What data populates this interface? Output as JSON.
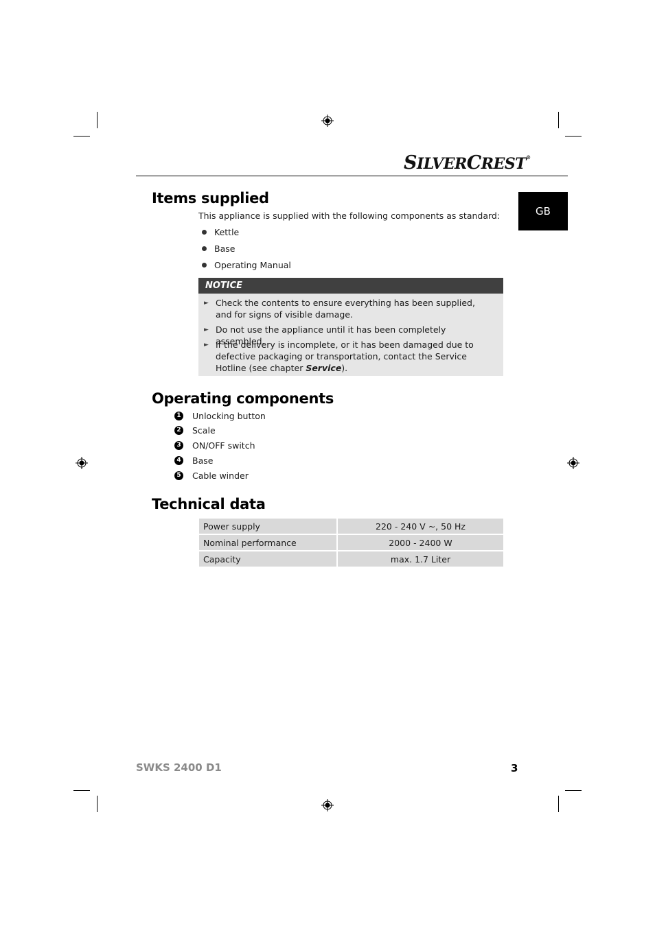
{
  "brand": {
    "logo_text_first": "S",
    "logo_text_rest_1": "ILVER",
    "logo_text_mid": "C",
    "logo_text_rest_2": "REST",
    "registered": "®"
  },
  "language_tab": "GB",
  "items_supplied": {
    "title": "Items supplied",
    "intro": "This appliance is supplied with the following components as standard:",
    "items": [
      "Kettle",
      "Base",
      "Operating Manual"
    ]
  },
  "notice": {
    "title": "NOTICE",
    "points": [
      {
        "text": "Check the contents to ensure everything has been supplied, and for signs of visible damage."
      },
      {
        "text": "Do not use the appliance until it has been completely assembled."
      },
      {
        "text": "If the delivery is incomplete, or it has been damaged due to defective packaging or transportation, contact the Service Hotline (see chapter ",
        "bold": "Service",
        "after": ")."
      }
    ]
  },
  "operating_components": {
    "title": "Operating components",
    "items": [
      {
        "num": "1",
        "label": "Unlocking button"
      },
      {
        "num": "2",
        "label": "Scale"
      },
      {
        "num": "3",
        "label": "ON/OFF switch"
      },
      {
        "num": "4",
        "label": "Base"
      },
      {
        "num": "5",
        "label": "Cable winder"
      }
    ]
  },
  "technical_data": {
    "title": "Technical data",
    "rows": [
      {
        "key": "Power supply",
        "value": "220 - 240 V ~, 50 Hz"
      },
      {
        "key": "Nominal performance",
        "value": "2000 - 2400 W"
      },
      {
        "key": "Capacity",
        "value": "max. 1.7 Liter"
      }
    ]
  },
  "footer": {
    "model": "SWKS 2400 D1",
    "page_number": "3"
  },
  "icons": {
    "registration_mark": "crosshair-target-icon",
    "notice_bullet": "triangle-right-icon",
    "list_bullet": "filled-circle-icon"
  }
}
